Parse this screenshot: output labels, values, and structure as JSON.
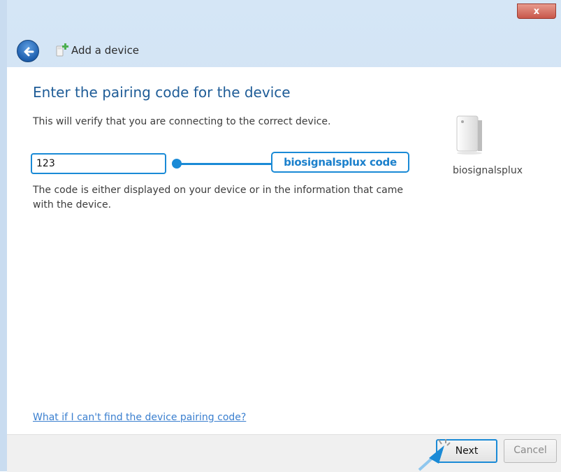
{
  "window": {
    "close_glyph": "x",
    "title": "Add a device"
  },
  "main": {
    "heading": "Enter the pairing code for the device",
    "description": "This will verify that you are connecting to the correct device.",
    "code_value": "123",
    "hint": "The code is either displayed on your device or in the information that came with the device.",
    "help_link": "What if I can't find the device pairing code?"
  },
  "annotation": {
    "callout_label": "biosignalsplux code"
  },
  "device": {
    "name": "biosignalsplux",
    "icon": "device-tower-icon"
  },
  "footer": {
    "next_label": "Next",
    "cancel_label": "Cancel"
  },
  "colors": {
    "accent": "#1a8ad6",
    "heading": "#1e5c97",
    "link": "#3a7fcf",
    "close": "#c8574a"
  }
}
